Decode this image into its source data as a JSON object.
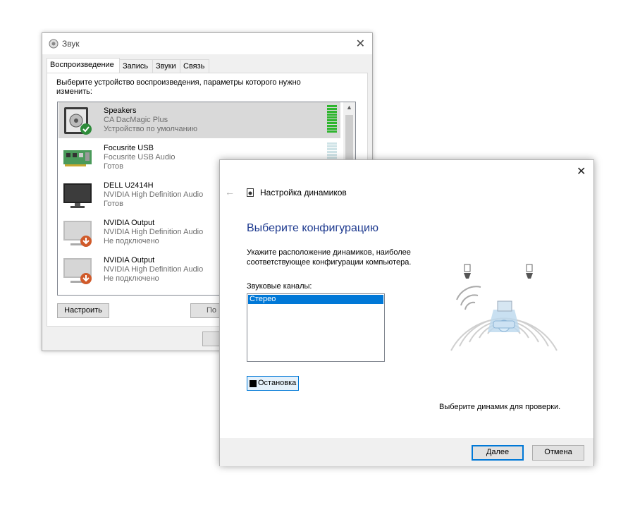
{
  "sound_window": {
    "title": "Звук",
    "tabs": [
      "Воспроизведение",
      "Запись",
      "Звуки",
      "Связь"
    ],
    "instruction": "Выберите устройство воспроизведения, параметры которого нужно изменить:",
    "devices": [
      {
        "name": "Speakers",
        "driver": "CA DacMagic Plus",
        "status": "Устройство по умолчанию",
        "icon": "speaker-icon",
        "selected": true
      },
      {
        "name": "Focusrite USB",
        "driver": "Focusrite USB Audio",
        "status": "Готов",
        "icon": "sound-card-icon",
        "selected": false
      },
      {
        "name": "DELL U2414H",
        "driver": "NVIDIA High Definition Audio",
        "status": "Готов",
        "icon": "monitor-icon",
        "selected": false
      },
      {
        "name": "NVIDIA Output",
        "driver": "NVIDIA High Definition Audio",
        "status": "Не подключено",
        "icon": "monitor-disconnected-icon",
        "selected": false
      },
      {
        "name": "NVIDIA Output",
        "driver": "NVIDIA High Definition Audio",
        "status": "Не подключено",
        "icon": "monitor-disconnected-icon",
        "selected": false
      }
    ],
    "configure_button": "Настроить",
    "properties_button_partial": "По"
  },
  "speaker_setup": {
    "title": "Настройка динамиков",
    "heading": "Выберите конфигурацию",
    "description": "Укажите расположение динамиков, наиболее соответствующее конфигурации компьютера.",
    "channels_label": "Звуковые каналы:",
    "channels": [
      "Стерео"
    ],
    "stop_button": "Остановка",
    "test_hint": "Выберите динамик для проверки.",
    "next_button": "Далее",
    "cancel_button": "Отмена"
  },
  "colors": {
    "accent": "#0078d7",
    "heading": "#1e3a8f",
    "meter_active": "#2fb52f",
    "meter_idle": "#cfe3e7"
  }
}
